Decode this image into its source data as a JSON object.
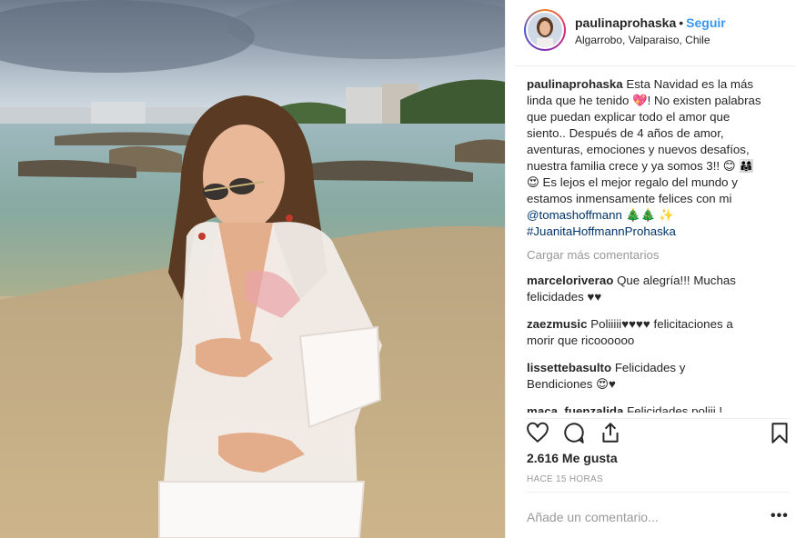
{
  "header": {
    "username": "paulinaprohaska",
    "separator": "•",
    "follow_label": "Seguir",
    "location": "Algarrobo, Valparaiso, Chile"
  },
  "caption": {
    "username": "paulinaprohaska",
    "text": "Esta Navidad es la más linda que he tenido 💖! No existen palabras que puedan explicar todo el amor que siento.. Después de 4 años de amor, aventuras, emociones y nuevos desafíos, nuestra familia crece y ya somos 3!! 😊 👨‍👩‍👧 😍 Es lejos el mejor regalo del mundo y estamos inmensamente felices con mi ",
    "mention": "@tomashoffmann",
    "text_after": " 🎄🎄 ✨",
    "hashtag": "#JuanitaHoffmannProhaska"
  },
  "load_more_label": "Cargar más comentarios",
  "comments": [
    {
      "username": "marceloriverao",
      "text": "Que alegría!!! Muchas felicidades ♥♥"
    },
    {
      "username": "zaezmusic",
      "text": "Poliiiii♥♥♥♥ felicitaciones a morir que ricoooooo"
    },
    {
      "username": "lissettebasulto",
      "text": "Felicidades y Bendiciones 😍♥"
    },
    {
      "username": "maca_fuenzalida",
      "text": "Felicidades poliii ! Éxito en esta nueva etapa! 😍💖"
    }
  ],
  "likes": "2.616 Me gusta",
  "timestamp": "HACE 15 HORAS",
  "add_comment_placeholder": "Añade un comentario...",
  "more_options": "•••",
  "icons": [
    "heart-icon",
    "comment-icon",
    "share-icon",
    "bookmark-icon",
    "heart-small-icon"
  ]
}
